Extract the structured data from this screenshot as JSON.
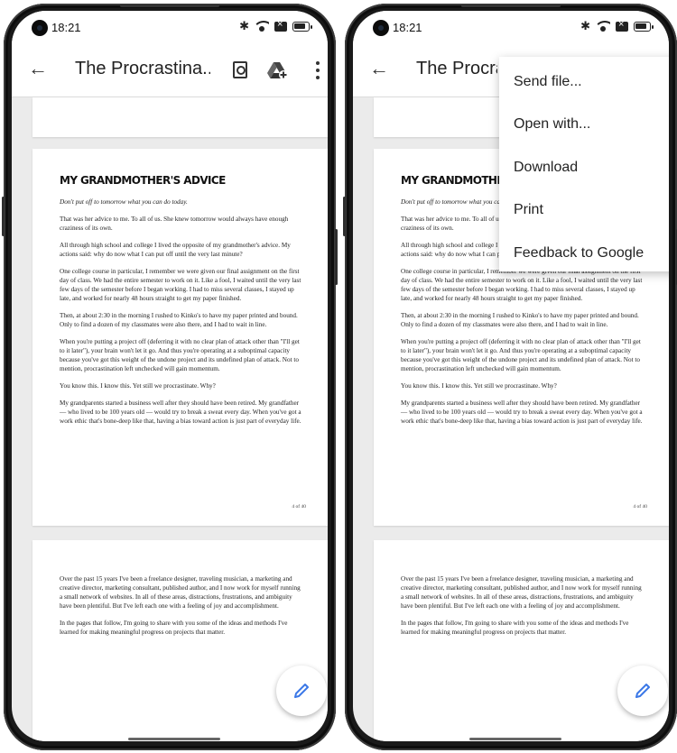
{
  "screens": [
    {
      "status": {
        "time": "18:21",
        "icons": [
          "bluetooth-icon",
          "wifi-icon",
          "sim-icon",
          "battery-icon"
        ]
      },
      "app_bar": {
        "title": "The Procrastina...",
        "actions": [
          "find-in-document-icon",
          "add-to-drive-icon",
          "more-vert-icon"
        ]
      },
      "menu_open": false
    },
    {
      "status": {
        "time": "18:21"
      },
      "app_bar": {
        "title": "The Procrastina..."
      },
      "menu_open": true,
      "menu": {
        "items": [
          "Send file...",
          "Open with...",
          "Download",
          "Print",
          "Feedback to Google"
        ]
      }
    }
  ],
  "document": {
    "page1": {
      "heading": "MY GRANDMOTHER'S ADVICE",
      "paragraphs": [
        "Don't put off to tomorrow what you can do today.",
        "That was her advice to me. To all of us. She knew tomorrow would always have enough craziness of its own.",
        "All through high school and college I lived the opposite of my grandmother's advice. My actions said: why do now what I can put off until the very last minute?",
        "One college course in particular, I remember we were given our final assignment on the first day of class. We had the entire semester to work on it. Like a fool, I waited until the very last few days of the semester before I began working. I had to miss several classes, I stayed up late, and worked for nearly 48 hours straight to get my paper finished.",
        "Then, at about 2:30 in the morning I rushed to Kinko's to have my paper printed and bound. Only to find a dozen of my classmates were also there, and I had to wait in line.",
        "When you're putting a project off (deferring it with no clear plan of attack other than \"I'll get to it later\"), your brain won't let it go. And thus you're operating at a suboptimal capacity because you've got this weight of the undone project and its undefined plan of attack. Not to mention, procrastination left unchecked will gain momentum.",
        "You know this. I know this. Yet still we procrastinate. Why?",
        "My grandparents started a business well after they should have been retired. My grandfather — who lived to be 100 years old — would try to break a sweat every day. When you've got a work ethic that's bone-deep like that, having a bias toward action is just part of everyday life."
      ],
      "page_number": "4 of 40"
    },
    "page2": {
      "paragraphs": [
        "Over the past 15 years I've been a freelance designer, traveling musician, a marketing and creative director, marketing consultant, published author, and I now work for myself running a small network of websites. In all of these areas, distractions, frustrations, and ambiguity have been plentiful. But I've left each one with a feeling of joy and accomplishment.",
        "In the pages that follow, I'm going to share with you some of the ideas and methods I've learned for making meaningful progress on projects that matter."
      ]
    }
  },
  "fab": {
    "icon": "edit-pencil-icon"
  },
  "colors": {
    "accent": "#3b78e7",
    "appbar_bg": "#ffffff",
    "viewer_bg": "#ebebeb",
    "text": "#222222"
  }
}
